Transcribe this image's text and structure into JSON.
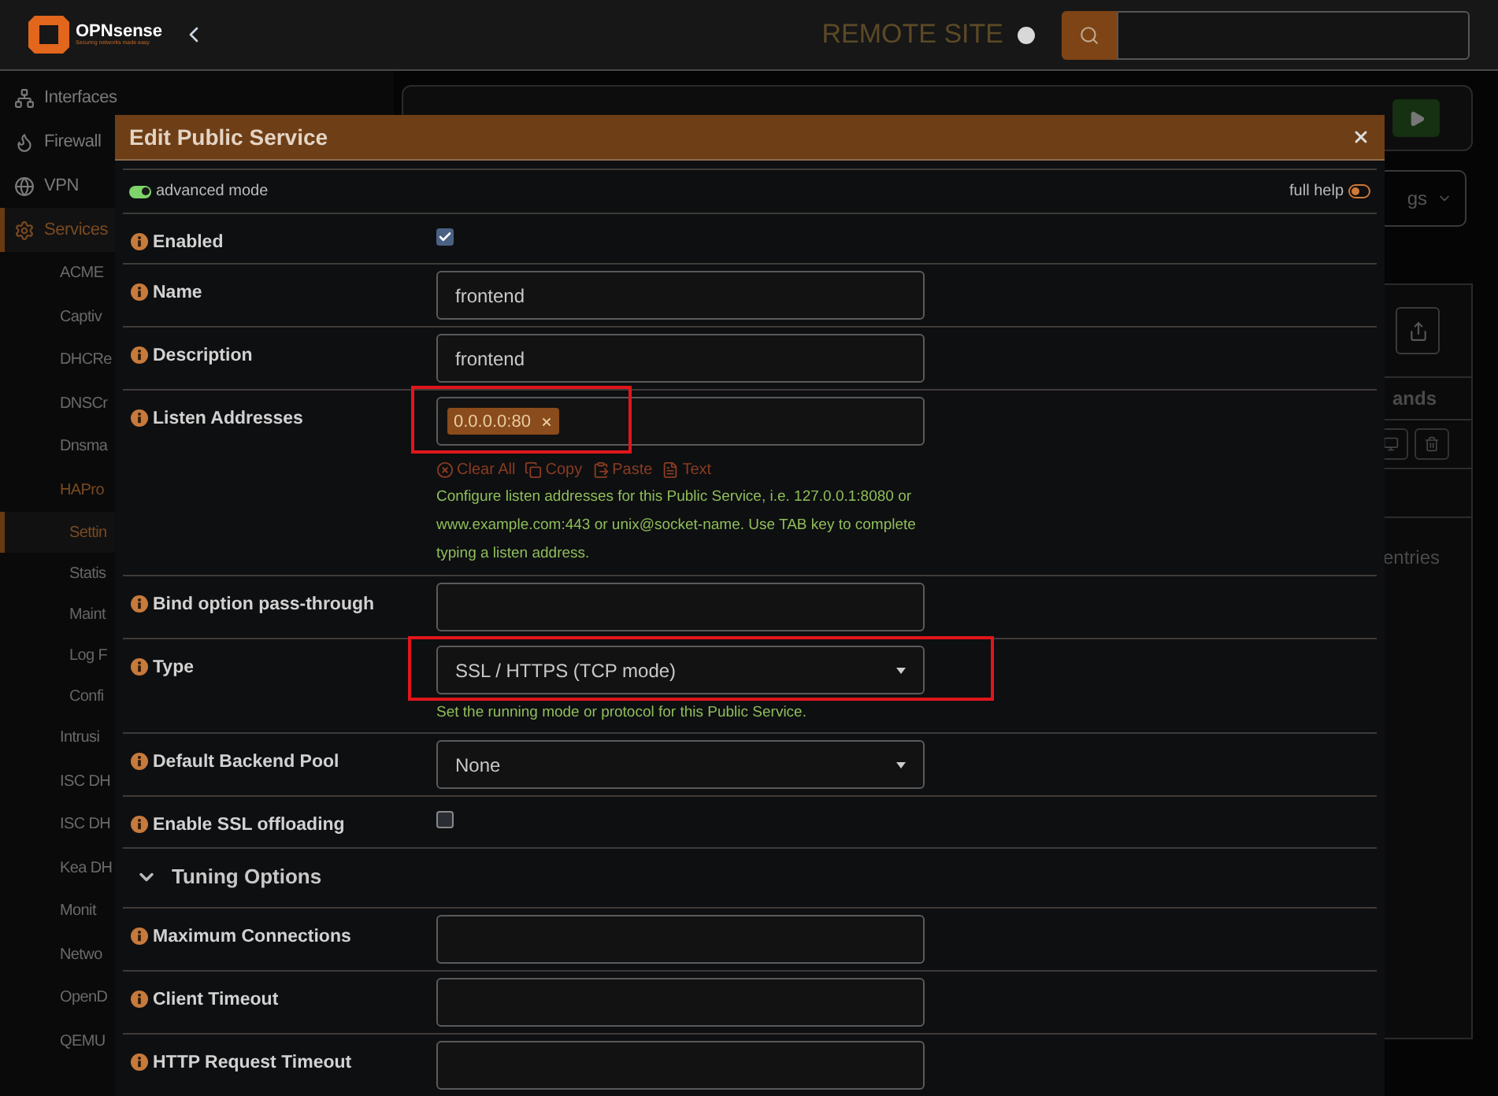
{
  "header": {
    "logo": {
      "name": "OPNsense",
      "tagline": "Securing networks made easy"
    },
    "site_label": "REMOTE SITE"
  },
  "sidebar": {
    "items": [
      {
        "label": "Interfaces",
        "selected": false
      },
      {
        "label": "Firewall",
        "selected": false
      },
      {
        "label": "VPN",
        "selected": false
      },
      {
        "label": "Services",
        "selected": true,
        "children": [
          {
            "label": "ACME",
            "selected": false
          },
          {
            "label": "Captiv",
            "selected": false
          },
          {
            "label": "DHCRe",
            "selected": false
          },
          {
            "label": "DNSCr",
            "selected": false
          },
          {
            "label": "Dnsma",
            "selected": false
          },
          {
            "label": "HAPro",
            "selected": true,
            "children": [
              {
                "label": "Settin",
                "selected": true
              },
              {
                "label": "Statis",
                "selected": false
              },
              {
                "label": "Maint",
                "selected": false
              },
              {
                "label": "Log F",
                "selected": false
              },
              {
                "label": "Confi",
                "selected": false
              }
            ]
          },
          {
            "label": "Intrusi",
            "selected": false
          },
          {
            "label": "ISC DH",
            "selected": false
          },
          {
            "label": "ISC DH",
            "selected": false
          },
          {
            "label": "Kea DH",
            "selected": false
          },
          {
            "label": "Monit",
            "selected": false
          },
          {
            "label": "Netwo",
            "selected": false
          },
          {
            "label": "OpenD",
            "selected": false
          },
          {
            "label": "QEMU",
            "selected": false
          }
        ]
      }
    ]
  },
  "background": {
    "dropdown": {
      "label": "gs"
    },
    "table": {
      "column": "ands",
      "footer": "entries"
    }
  },
  "modal": {
    "title": "Edit Public Service",
    "advanced_mode": {
      "label": "advanced mode",
      "on": true
    },
    "full_help": {
      "label": "full help",
      "on": false
    },
    "fields": [
      {
        "kind": "checkbox",
        "label": "Enabled",
        "checked": true,
        "highlighted": false
      },
      {
        "kind": "text",
        "label": "Name",
        "value": "frontend",
        "highlighted": false
      },
      {
        "kind": "text",
        "label": "Description",
        "value": "frontend",
        "highlighted": false
      },
      {
        "kind": "tags",
        "label": "Listen Addresses",
        "tags": [
          "0.0.0.0:80"
        ],
        "highlighted": true,
        "actions": [
          "Clear All",
          "Copy",
          "Paste",
          "Text"
        ],
        "help": "Configure listen addresses for this Public Service, i.e. 127.0.0.1:8080 or www.example.com:443 or unix@socket-name. Use TAB key to complete typing a listen address."
      },
      {
        "kind": "text",
        "label": "Bind option pass-through",
        "highlighted": false
      },
      {
        "kind": "select",
        "label": "Type",
        "value": "SSL / HTTPS (TCP mode)",
        "highlighted": true,
        "help": "Set the running mode or protocol for this Public Service."
      },
      {
        "kind": "select",
        "label": "Default Backend Pool",
        "value": "None",
        "highlighted": false
      },
      {
        "kind": "checkbox",
        "label": "Enable SSL offloading",
        "checked": false,
        "highlighted": false
      },
      {
        "kind": "section",
        "label": "Tuning Options",
        "expanded": true
      },
      {
        "kind": "text",
        "label": "Maximum Connections",
        "highlighted": false
      },
      {
        "kind": "text",
        "label": "Client Timeout",
        "highlighted": false
      },
      {
        "kind": "text",
        "label": "HTTP Request Timeout",
        "highlighted": false
      }
    ]
  }
}
